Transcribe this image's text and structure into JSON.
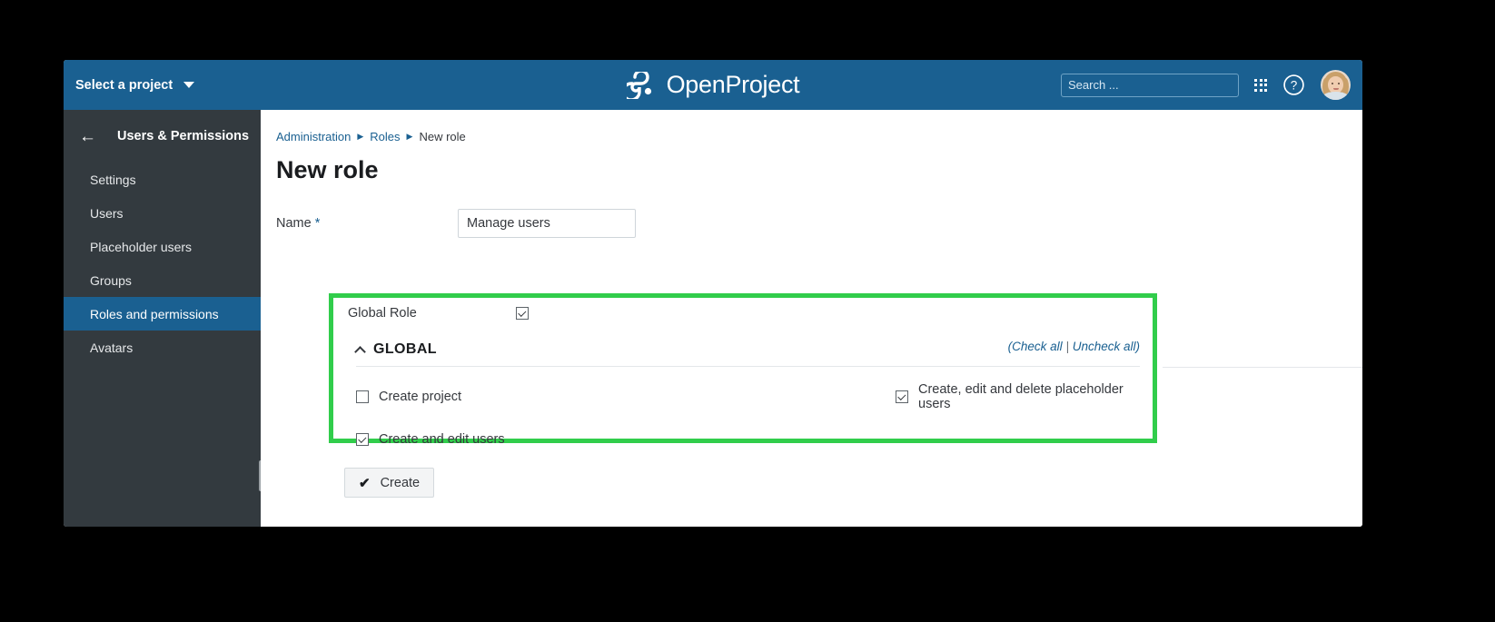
{
  "header": {
    "project_select_label": "Select a project",
    "caret_icon": "chevron-down-icon",
    "logo_text": "OpenProject",
    "logo_icon": "openproject-logo-icon",
    "search_placeholder": "Search ...",
    "search_value": "",
    "search_icon": "search-icon",
    "grid_icon": "apps-grid-icon",
    "help_icon": "help-circle-icon",
    "avatar_icon": "user-avatar",
    "background_color": "#1a6091"
  },
  "sidebar": {
    "back_icon": "arrow-left-icon",
    "title": "Users & Permissions",
    "active_color": "#1a6091",
    "background_color": "#333a3f",
    "items": [
      {
        "label": "Settings",
        "active": false
      },
      {
        "label": "Users",
        "active": false
      },
      {
        "label": "Placeholder users",
        "active": false
      },
      {
        "label": "Groups",
        "active": false
      },
      {
        "label": "Roles and permissions",
        "active": true
      },
      {
        "label": "Avatars",
        "active": false
      }
    ]
  },
  "breadcrumb": {
    "item1": "Administration",
    "item2": "Roles",
    "current": "New role",
    "separator": "▶"
  },
  "main": {
    "page_title": "New role",
    "name_label": "Name",
    "name_required_mark": "*",
    "name_value": "Manage users",
    "name_placeholder": ""
  },
  "permissions_panel": {
    "highlight_color": "#31cd4b",
    "global_role_label": "Global Role",
    "global_role_checked": true,
    "section_title": "GLOBAL",
    "collapse_icon": "chevron-up-icon",
    "check_all_prefix": "(",
    "check_all_label": "Check all",
    "check_all_divider": "|",
    "uncheck_all_label": "Uncheck all",
    "check_all_suffix": ")",
    "permissions": [
      {
        "label": "Create project",
        "checked": false
      },
      {
        "label": "Create, edit and delete placeholder users",
        "checked": true
      },
      {
        "label": "Create and edit users",
        "checked": true
      }
    ]
  },
  "footer": {
    "create_label": "Create",
    "create_icon": "checkmark-icon"
  }
}
